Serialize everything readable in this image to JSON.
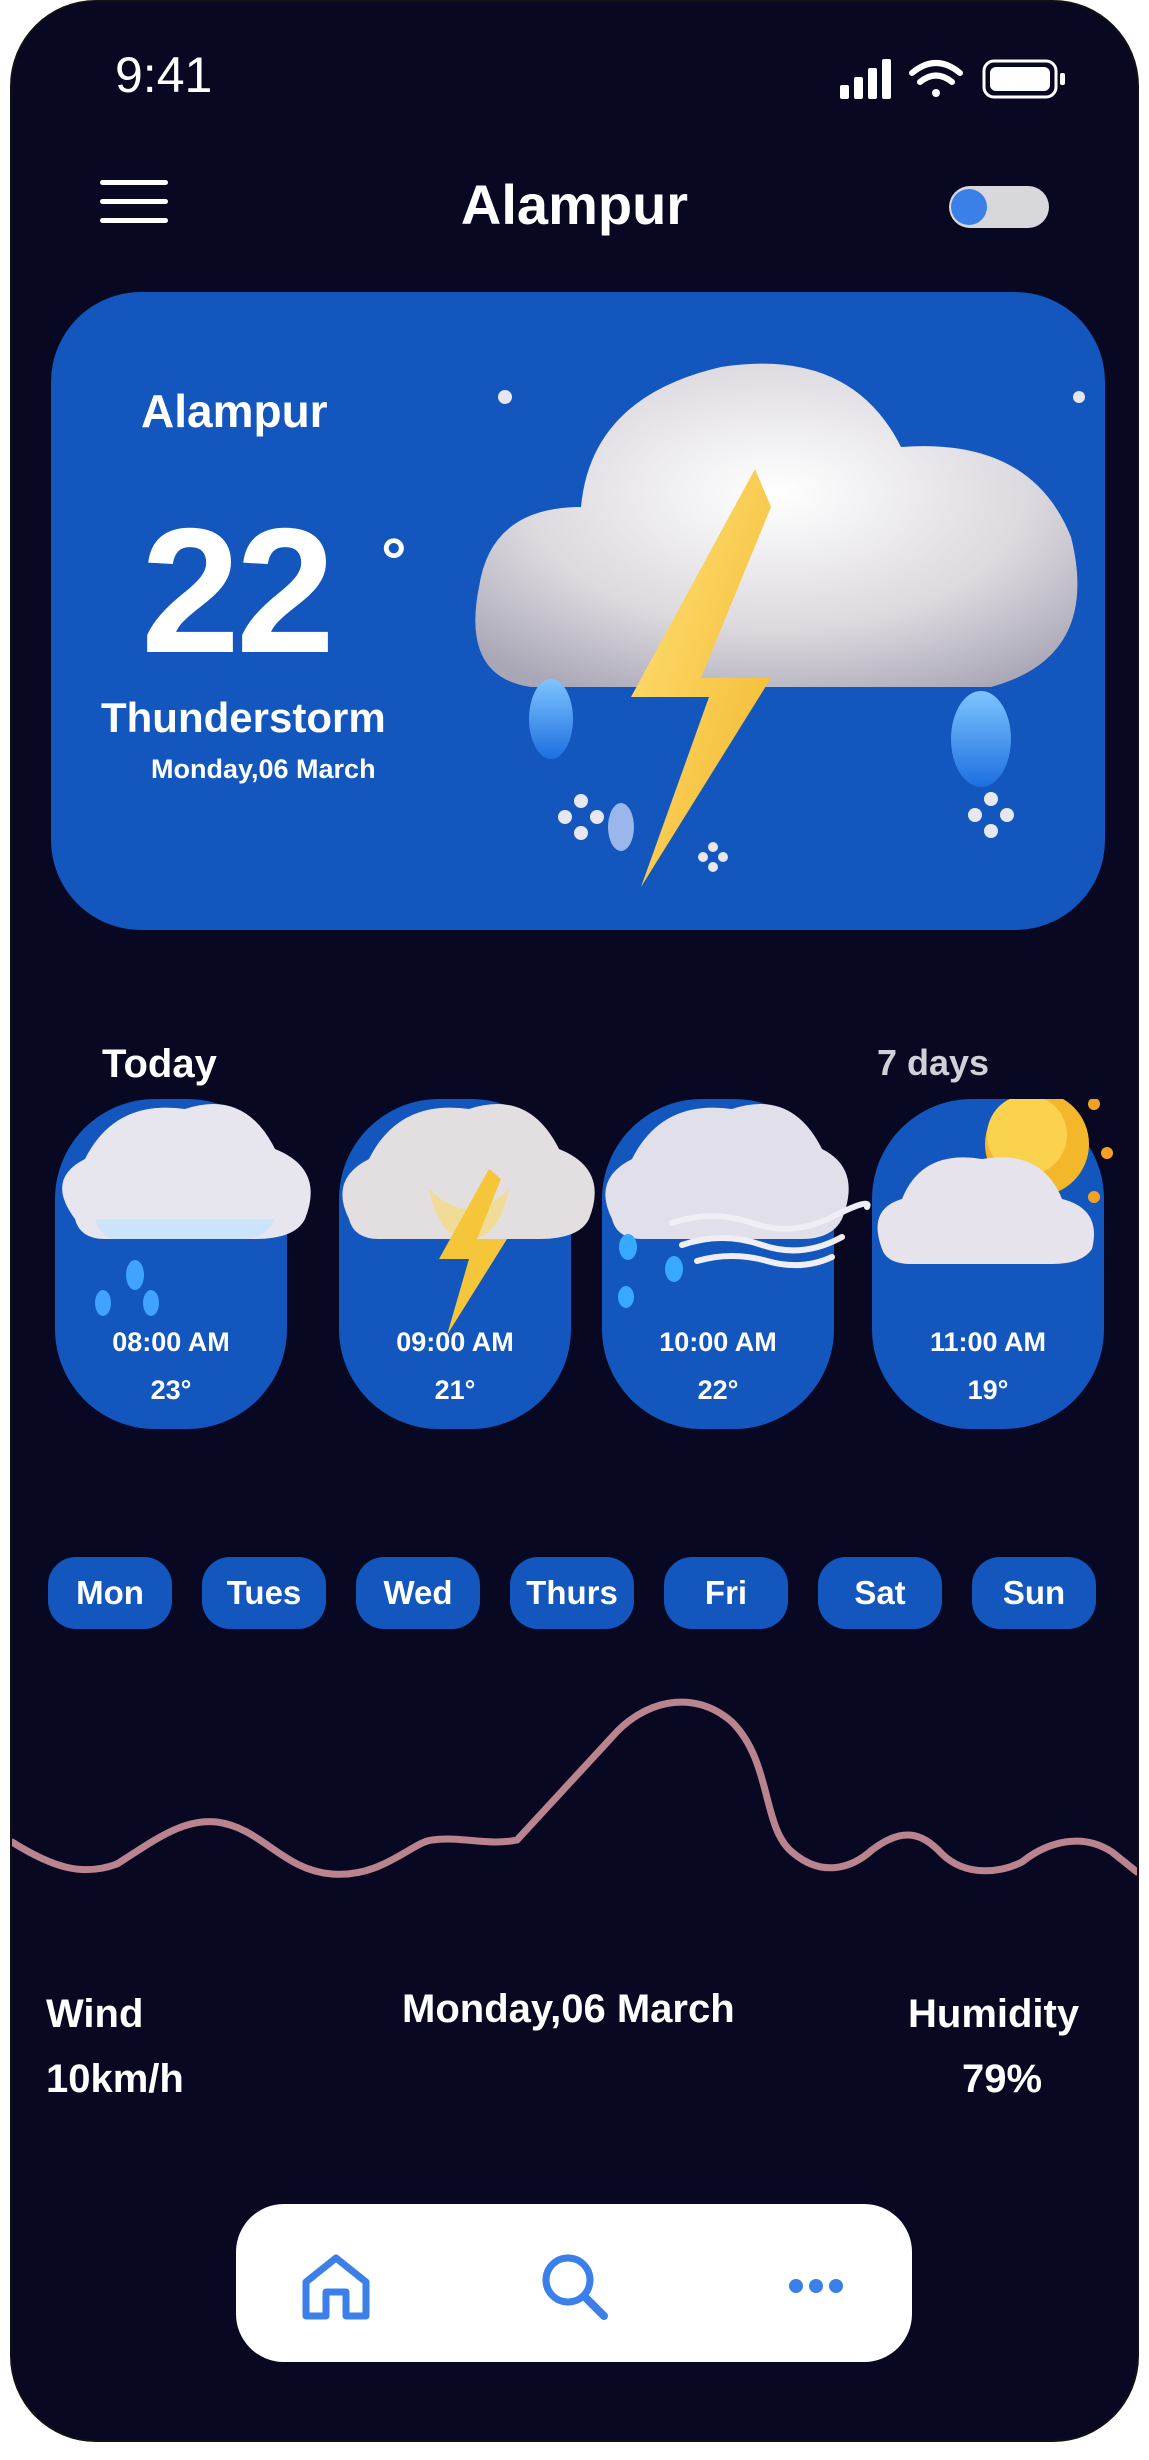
{
  "status_bar": {
    "time": "9:41",
    "icons": [
      "signal-icon",
      "wifi-icon",
      "battery-icon"
    ]
  },
  "header": {
    "title": "Alampur",
    "menu_icon": "menu-icon",
    "toggle": "theme-toggle"
  },
  "hero": {
    "city": "Alampur",
    "temperature": "22",
    "degree_symbol": "°",
    "condition": "Thunderstorm",
    "date": "Monday,06 March",
    "icon": "thunderstorm-cloud-icon"
  },
  "hourly": {
    "label": "Today",
    "week_link": "7 days",
    "items": [
      {
        "time": "08:00 AM",
        "temp": "23°",
        "icon": "rain-cloud-icon"
      },
      {
        "time": "09:00 AM",
        "temp": "21°",
        "icon": "lightning-cloud-icon"
      },
      {
        "time": "10:00 AM",
        "temp": "22°",
        "icon": "windy-rain-cloud-icon"
      },
      {
        "time": "11:00 AM",
        "temp": "19°",
        "icon": "sun-cloud-icon"
      }
    ]
  },
  "days": [
    "Mon",
    "Tues",
    "Wed",
    "Thurs",
    "Fri",
    "Sat",
    "Sun"
  ],
  "details": {
    "wind_label": "Wind",
    "wind_value": "10km/h",
    "date": "Monday,06 March",
    "humidity_label": "Humidity",
    "humidity_value": "79%"
  },
  "nav": {
    "items": [
      "home-icon",
      "search-icon",
      "more-icon"
    ]
  },
  "colors": {
    "background": "#090822",
    "card": "#1256be",
    "accent": "#3a80e8",
    "line": "#b9848d"
  }
}
